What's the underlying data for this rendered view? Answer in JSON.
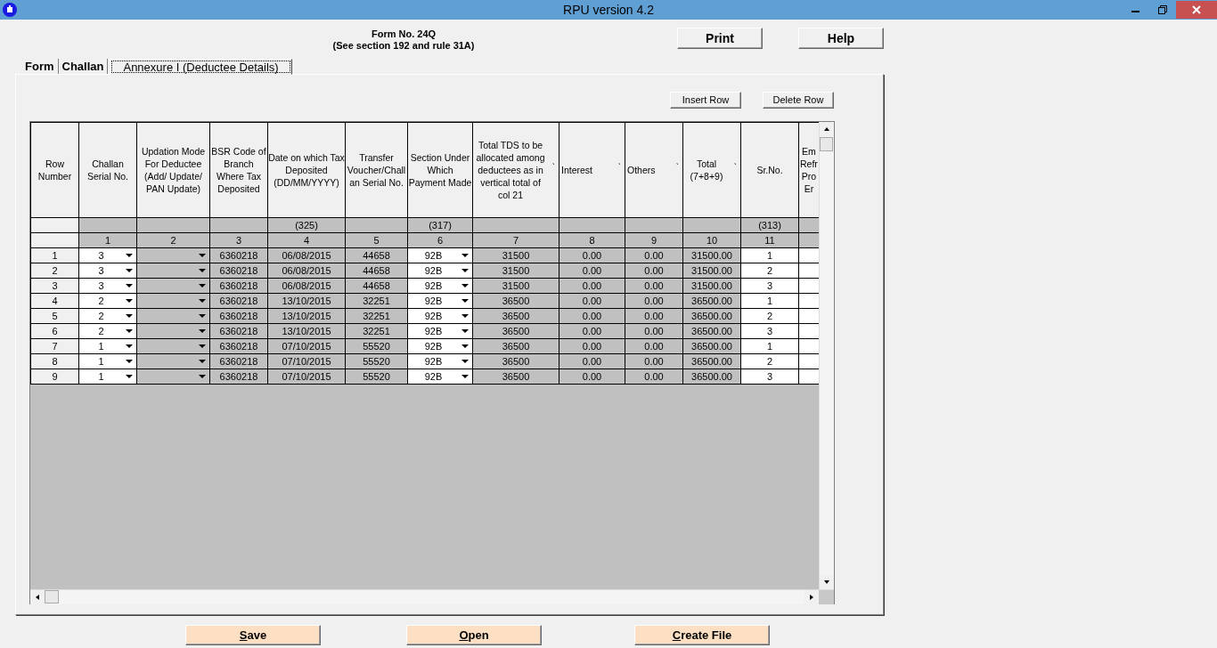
{
  "window": {
    "title": "RPU version 4.2"
  },
  "form_title": {
    "line_1": "Form No. 24Q",
    "line_2": "(See section 192 and rule 31A)"
  },
  "top_buttons": [
    {
      "label": "Print"
    },
    {
      "label": "Help"
    }
  ],
  "tabs": [
    {
      "label": "Form",
      "selected": false
    },
    {
      "label": "Challan",
      "selected": false
    },
    {
      "label": "Annexure I (Deductee Details)",
      "selected": true
    }
  ],
  "grid_buttons": [
    {
      "label": "Insert Row"
    },
    {
      "label": "Delete Row"
    }
  ],
  "grid": {
    "columns": [
      {
        "heading": "Row Number",
        "kind": "row-number"
      },
      {
        "heading": "Challan Serial No.",
        "kind": "dropdown",
        "editable": true,
        "number": "1"
      },
      {
        "heading": "Updation Mode For Deductee (Add/  Update/ PAN Update)",
        "kind": "dropdown",
        "editable": false,
        "number": "2"
      },
      {
        "heading": "BSR Code of Branch Where Tax Deposited",
        "kind": "text",
        "editable": false,
        "number": "3"
      },
      {
        "heading": "Date on which Tax  Deposited (DD/MM/YYYY)",
        "kind": "text",
        "editable": false,
        "code": "(325)",
        "number": "4"
      },
      {
        "heading": "Transfer Voucher/Challan Serial No.",
        "kind": "text",
        "editable": false,
        "number": "5"
      },
      {
        "heading": "Section Under Which Payment Made",
        "kind": "dropdown",
        "editable": true,
        "code": "(317)",
        "number": "6"
      },
      {
        "heading": "Total TDS to be allocated among deductees as in vertical total of col 21",
        "kind": "text",
        "editable": false,
        "mark": "`",
        "number": "7"
      },
      {
        "heading": "Interest",
        "kind": "text",
        "editable": false,
        "mark": "`",
        "number": "8"
      },
      {
        "heading": "Others",
        "kind": "text",
        "editable": false,
        "mark": "`",
        "number": "9"
      },
      {
        "heading": "Total (7+8+9)",
        "kind": "text",
        "editable": false,
        "mark": "`",
        "number": "10"
      },
      {
        "heading": "Sr.No.",
        "kind": "text",
        "editable": true,
        "code": "(313)",
        "number": "11"
      },
      {
        "heading": "Em\nRefr\nPro\nEr",
        "kind": "text",
        "editable": true
      }
    ],
    "rows": [
      {
        "cells": [
          "1",
          "3",
          null,
          "6360218",
          "06/08/2015",
          "44658",
          "92B",
          "31500",
          "0.00",
          "0.00",
          "31500.00",
          "1",
          null
        ]
      },
      {
        "cells": [
          "2",
          "3",
          null,
          "6360218",
          "06/08/2015",
          "44658",
          "92B",
          "31500",
          "0.00",
          "0.00",
          "31500.00",
          "2",
          null
        ]
      },
      {
        "cells": [
          "3",
          "3",
          null,
          "6360218",
          "06/08/2015",
          "44658",
          "92B",
          "31500",
          "0.00",
          "0.00",
          "31500.00",
          "3",
          null
        ]
      },
      {
        "cells": [
          "4",
          "2",
          null,
          "6360218",
          "13/10/2015",
          "32251",
          "92B",
          "36500",
          "0.00",
          "0.00",
          "36500.00",
          "1",
          null
        ]
      },
      {
        "cells": [
          "5",
          "2",
          null,
          "6360218",
          "13/10/2015",
          "32251",
          "92B",
          "36500",
          "0.00",
          "0.00",
          "36500.00",
          "2",
          null
        ]
      },
      {
        "cells": [
          "6",
          "2",
          null,
          "6360218",
          "13/10/2015",
          "32251",
          "92B",
          "36500",
          "0.00",
          "0.00",
          "36500.00",
          "3",
          null
        ]
      },
      {
        "cells": [
          "7",
          "1",
          null,
          "6360218",
          "07/10/2015",
          "55520",
          "92B",
          "36500",
          "0.00",
          "0.00",
          "36500.00",
          "1",
          null
        ]
      },
      {
        "cells": [
          "8",
          "1",
          null,
          "6360218",
          "07/10/2015",
          "55520",
          "92B",
          "36500",
          "0.00",
          "0.00",
          "36500.00",
          "2",
          null
        ]
      },
      {
        "cells": [
          "9",
          "1",
          null,
          "6360218",
          "07/10/2015",
          "55520",
          "92B",
          "36500",
          "0.00",
          "0.00",
          "36500.00",
          "3",
          null
        ]
      }
    ]
  },
  "bottom_buttons": [
    {
      "label": "Save",
      "underline_first": true
    },
    {
      "label": "Open",
      "underline_first": true
    },
    {
      "label": "Create File",
      "underline_first": true
    }
  ]
}
